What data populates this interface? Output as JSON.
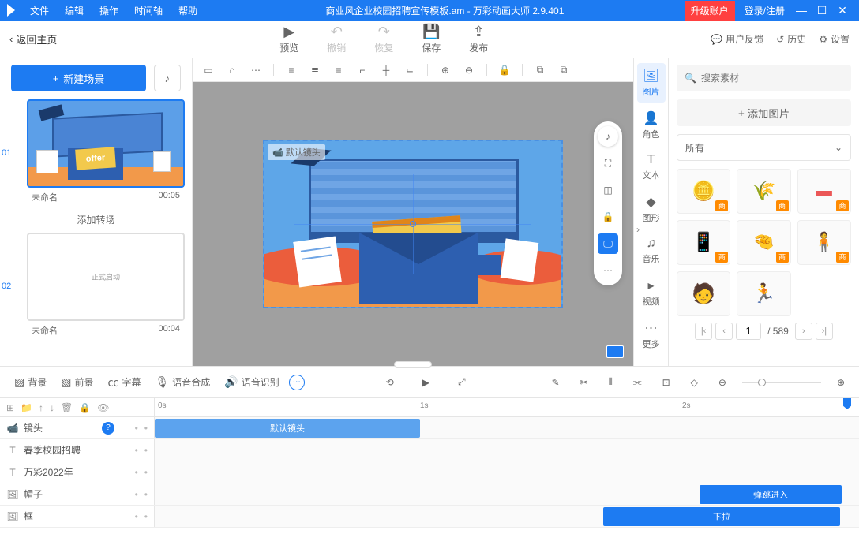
{
  "titleBar": {
    "menus": [
      "文件",
      "编辑",
      "操作",
      "时间轴",
      "帮助"
    ],
    "documentTitle": "商业风企业校园招聘宣传模板.am - 万彩动画大师 2.9.401",
    "upgrade": "升级账户",
    "login": "登录/注册"
  },
  "toolbar": {
    "back": "返回主页",
    "preview": "预览",
    "undo": "撤销",
    "redo": "恢复",
    "save": "保存",
    "publish": "发布",
    "feedback": "用户反馈",
    "history": "历史",
    "settings": "设置"
  },
  "leftPanel": {
    "newScene": "新建场景",
    "addTransition": "添加转场",
    "scenes": [
      {
        "num": "01",
        "name": "未命名",
        "duration": "00:05",
        "selected": true
      },
      {
        "num": "02",
        "name": "未命名",
        "duration": "00:04",
        "selected": false,
        "placeholder": "正式启动"
      }
    ]
  },
  "canvas": {
    "defaultCamera": "默认镜头",
    "offerText": "offer"
  },
  "rightTabs": {
    "image": "图片",
    "role": "角色",
    "text": "文本",
    "shape": "图形",
    "music": "音乐",
    "video": "视频",
    "more": "更多"
  },
  "rightPanel": {
    "searchPlaceholder": "搜索素材",
    "addImage": "添加图片",
    "filterAll": "所有",
    "assetBadge": "商",
    "currentPage": "1",
    "totalPages": "/ 589"
  },
  "midToolbar": {
    "background": "背景",
    "foreground": "前景",
    "subtitle": "字幕",
    "tts": "语音合成",
    "asr": "语音识别"
  },
  "timeline": {
    "marks": [
      "0s",
      "1s",
      "2s"
    ],
    "rows": [
      {
        "icon": "cam",
        "label": "镜头",
        "clipLabel": "默认镜头",
        "clipWidth": 336,
        "clipLeft": 0,
        "help": true
      },
      {
        "icon": "T",
        "label": "春季校园招聘"
      },
      {
        "icon": "T",
        "label": "万彩2022年"
      },
      {
        "icon": "img",
        "label": "帽子",
        "clipLabel": "弹跳进入",
        "clipWidth": 180,
        "clipLeft": 690,
        "dark": true
      },
      {
        "icon": "img",
        "label": "框",
        "clipLabel": "下拉",
        "clipWidth": 266,
        "clipLeft": 568,
        "dark": true
      }
    ]
  }
}
